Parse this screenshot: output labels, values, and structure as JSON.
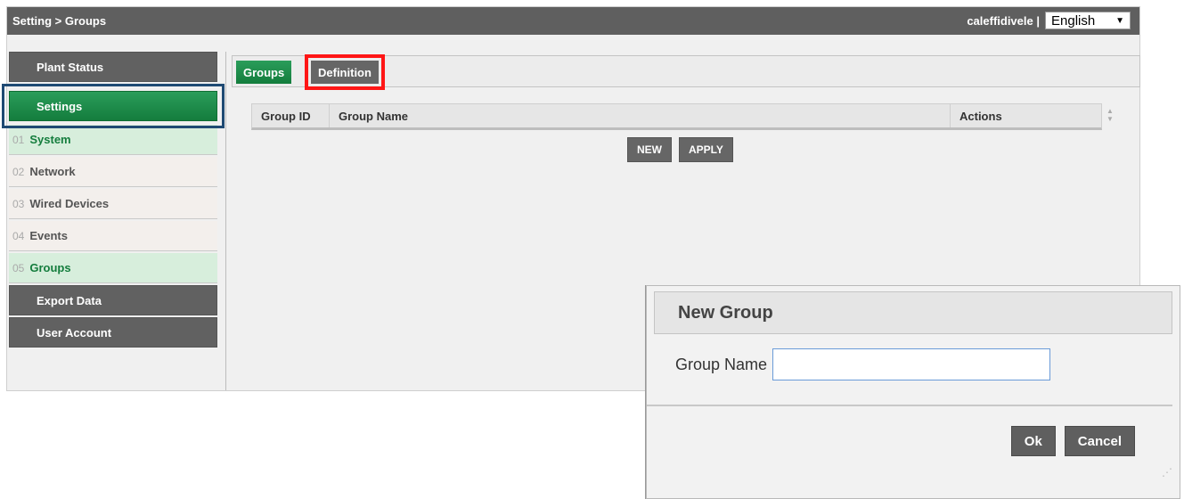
{
  "header": {
    "breadcrumb": "Setting > Groups",
    "username": "caleffidivele |",
    "language": "English"
  },
  "sidebar": {
    "plant_status": "Plant Status",
    "settings": "Settings",
    "subitems": [
      {
        "num": "01",
        "label": "System"
      },
      {
        "num": "02",
        "label": "Network"
      },
      {
        "num": "03",
        "label": "Wired Devices"
      },
      {
        "num": "04",
        "label": "Events"
      },
      {
        "num": "05",
        "label": "Groups"
      }
    ],
    "export_data": "Export Data",
    "user_account": "User Account"
  },
  "tabs": {
    "groups": "Groups",
    "definition": "Definition"
  },
  "table": {
    "columns": [
      "Group ID",
      "Group Name",
      "Actions"
    ]
  },
  "buttons": {
    "new": "NEW",
    "apply": "APPLY"
  },
  "dialog": {
    "title": "New Group",
    "field_label": "Group Name",
    "field_value": "",
    "ok": "Ok",
    "cancel": "Cancel"
  },
  "colors": {
    "accent_green": "#147d3d",
    "topbar": "#5f5f5f",
    "highlight_red": "#ff1616",
    "highlight_blue": "#1f4a73"
  }
}
